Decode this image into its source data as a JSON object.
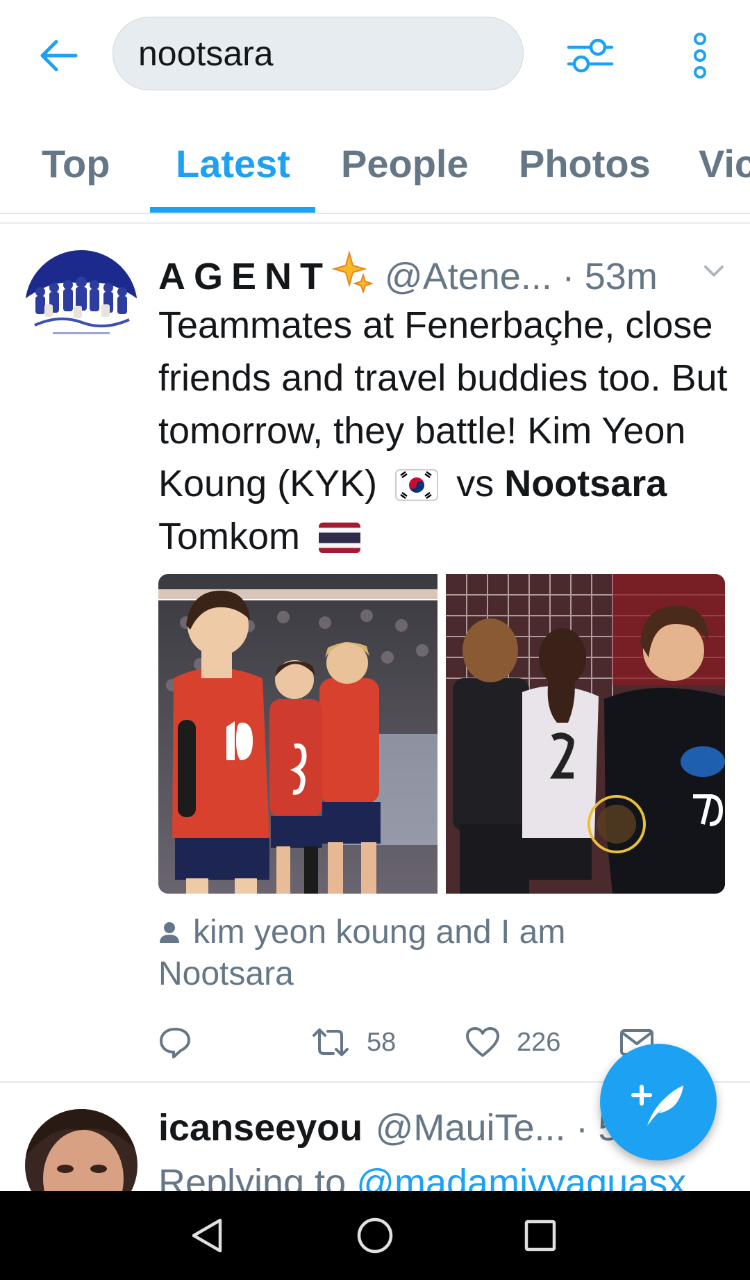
{
  "search": {
    "query": "nootsara"
  },
  "tabs": [
    {
      "label": "Top"
    },
    {
      "label": "Latest"
    },
    {
      "label": "People"
    },
    {
      "label": "Photos"
    },
    {
      "label": "Vic"
    }
  ],
  "active_tab": "Latest",
  "tweets": [
    {
      "display_name": "AGENT",
      "handle": "@Atene...",
      "separator": "·",
      "time": "53m",
      "text_before": "Teammates at Fenerbaçhe, close friends and travel buddies too. But tomorrow, they battle! Kim Yeon Koung (KYK)",
      "text_vs": "vs",
      "text_bold": "Nootsara",
      "text_after": "Tomkom",
      "flags": [
        "south-korea-flag",
        "thailand-flag"
      ],
      "media": [
        {
          "description": "volleyball-player-photo-1"
        },
        {
          "description": "volleyball-player-photo-2"
        }
      ],
      "tagged_line1": "kim yeon koung and I am",
      "tagged_line2": "Nootsara",
      "retweets": "58",
      "likes": "226"
    },
    {
      "display_name": "icanseeyou",
      "handle": "@MauiTe...",
      "separator": "·",
      "time_partial": "5",
      "replying_prefix": "Replying to",
      "replying_mention": "@madamivyaguasx"
    }
  ],
  "icons": {
    "back": "arrow-left-icon",
    "filter": "sliders-icon",
    "more": "vertical-dots-icon",
    "reply": "comment-icon",
    "retweet": "retweet-icon",
    "like": "heart-icon",
    "dm": "envelope-icon",
    "compose": "feather-plus-icon"
  },
  "colors": {
    "accent": "#1da1f2",
    "muted": "#657786",
    "text": "#14171a",
    "search_bg": "#e6ecf0"
  }
}
